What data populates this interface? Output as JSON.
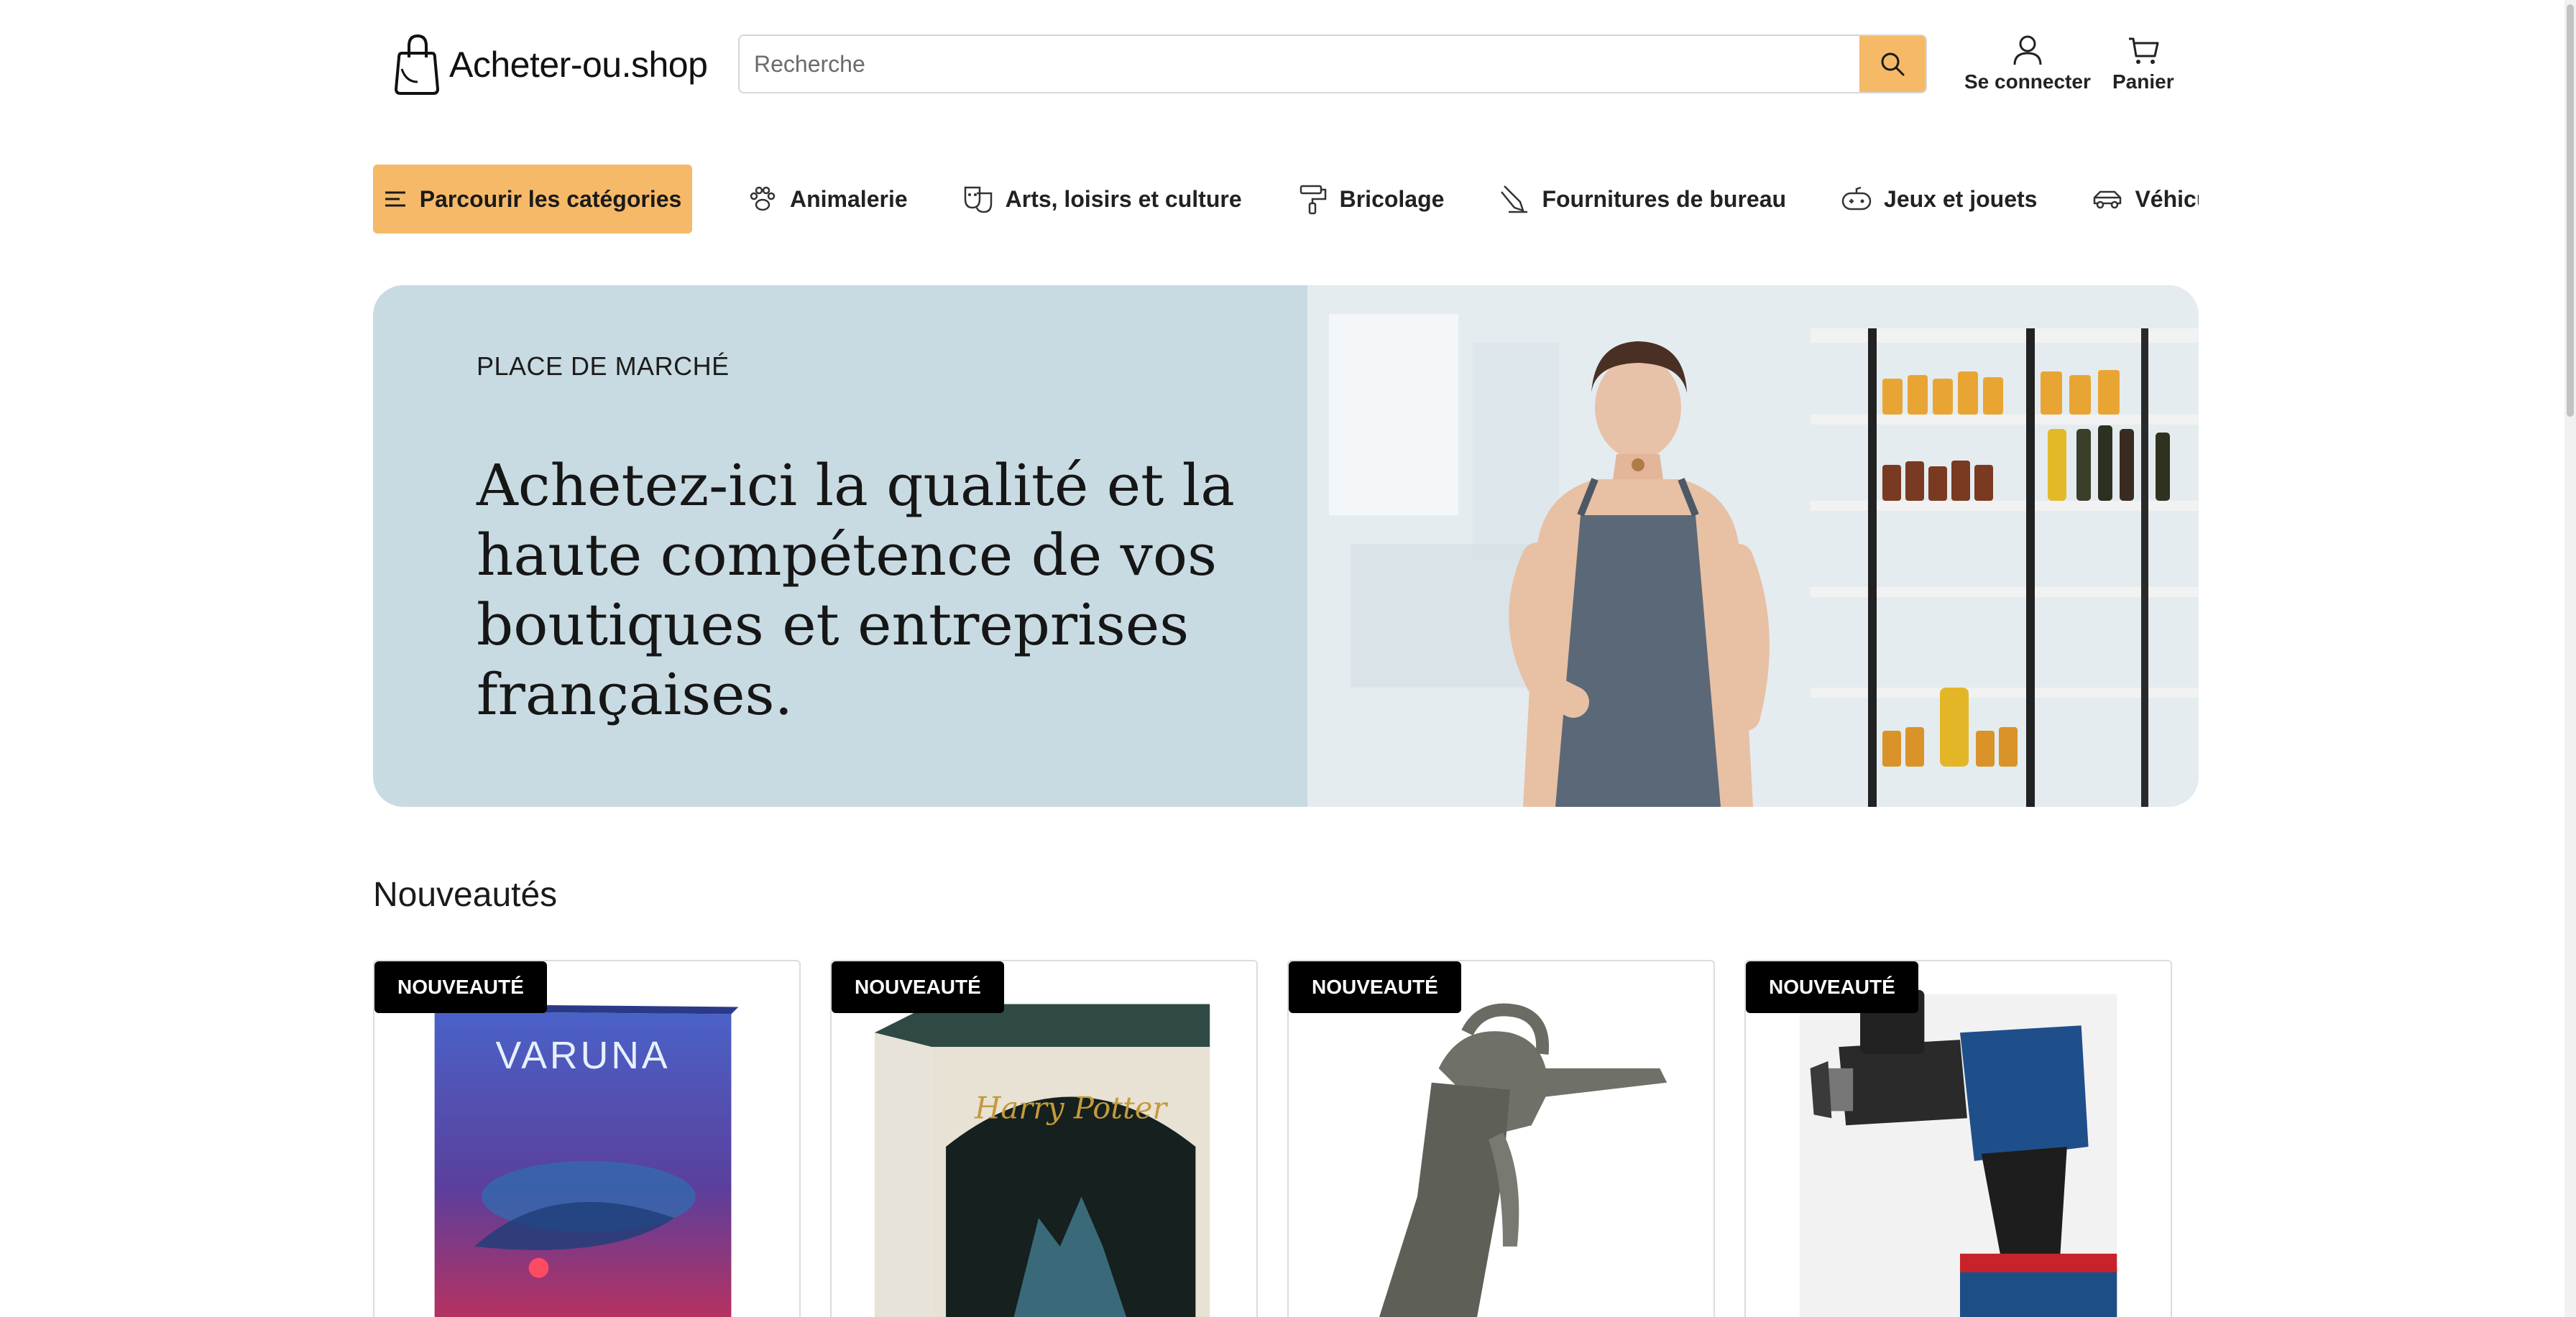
{
  "logo": {
    "text": "Acheter-ou.shop"
  },
  "search": {
    "placeholder": "Recherche"
  },
  "header_actions": {
    "login_label": "Se connecter",
    "cart_label": "Panier"
  },
  "nav": {
    "browse_label": "Parcourir les catégories",
    "categories": [
      {
        "label": "Animalerie",
        "icon": "paw-icon"
      },
      {
        "label": "Arts, loisirs et culture",
        "icon": "theater-masks-icon"
      },
      {
        "label": "Bricolage",
        "icon": "paint-roller-icon"
      },
      {
        "label": "Fournitures de bureau",
        "icon": "pen-icon"
      },
      {
        "label": "Jeux et jouets",
        "icon": "gamepad-icon"
      },
      {
        "label": "Véhicules et acce",
        "icon": "car-icon"
      }
    ]
  },
  "hero": {
    "eyebrow": "PLACE DE MARCHÉ",
    "title": "Achetez-ici la qualité et la haute compétence de vos boutiques et entreprises françaises."
  },
  "section": {
    "title": "Nouveautés"
  },
  "products": [
    {
      "badge": "NOUVEAUTÉ",
      "image": "Varuna board game box"
    },
    {
      "badge": "NOUVEAUTÉ",
      "image": "Harry Potter board game box"
    },
    {
      "badge": "NOUVEAUTÉ",
      "image": "air blow gun"
    },
    {
      "badge": "NOUVEAUTÉ",
      "image": "Bosch cordless drill"
    }
  ],
  "colors": {
    "accent": "#f6b968",
    "hero_bg": "#c9dbe2",
    "badge_bg": "#000000"
  }
}
